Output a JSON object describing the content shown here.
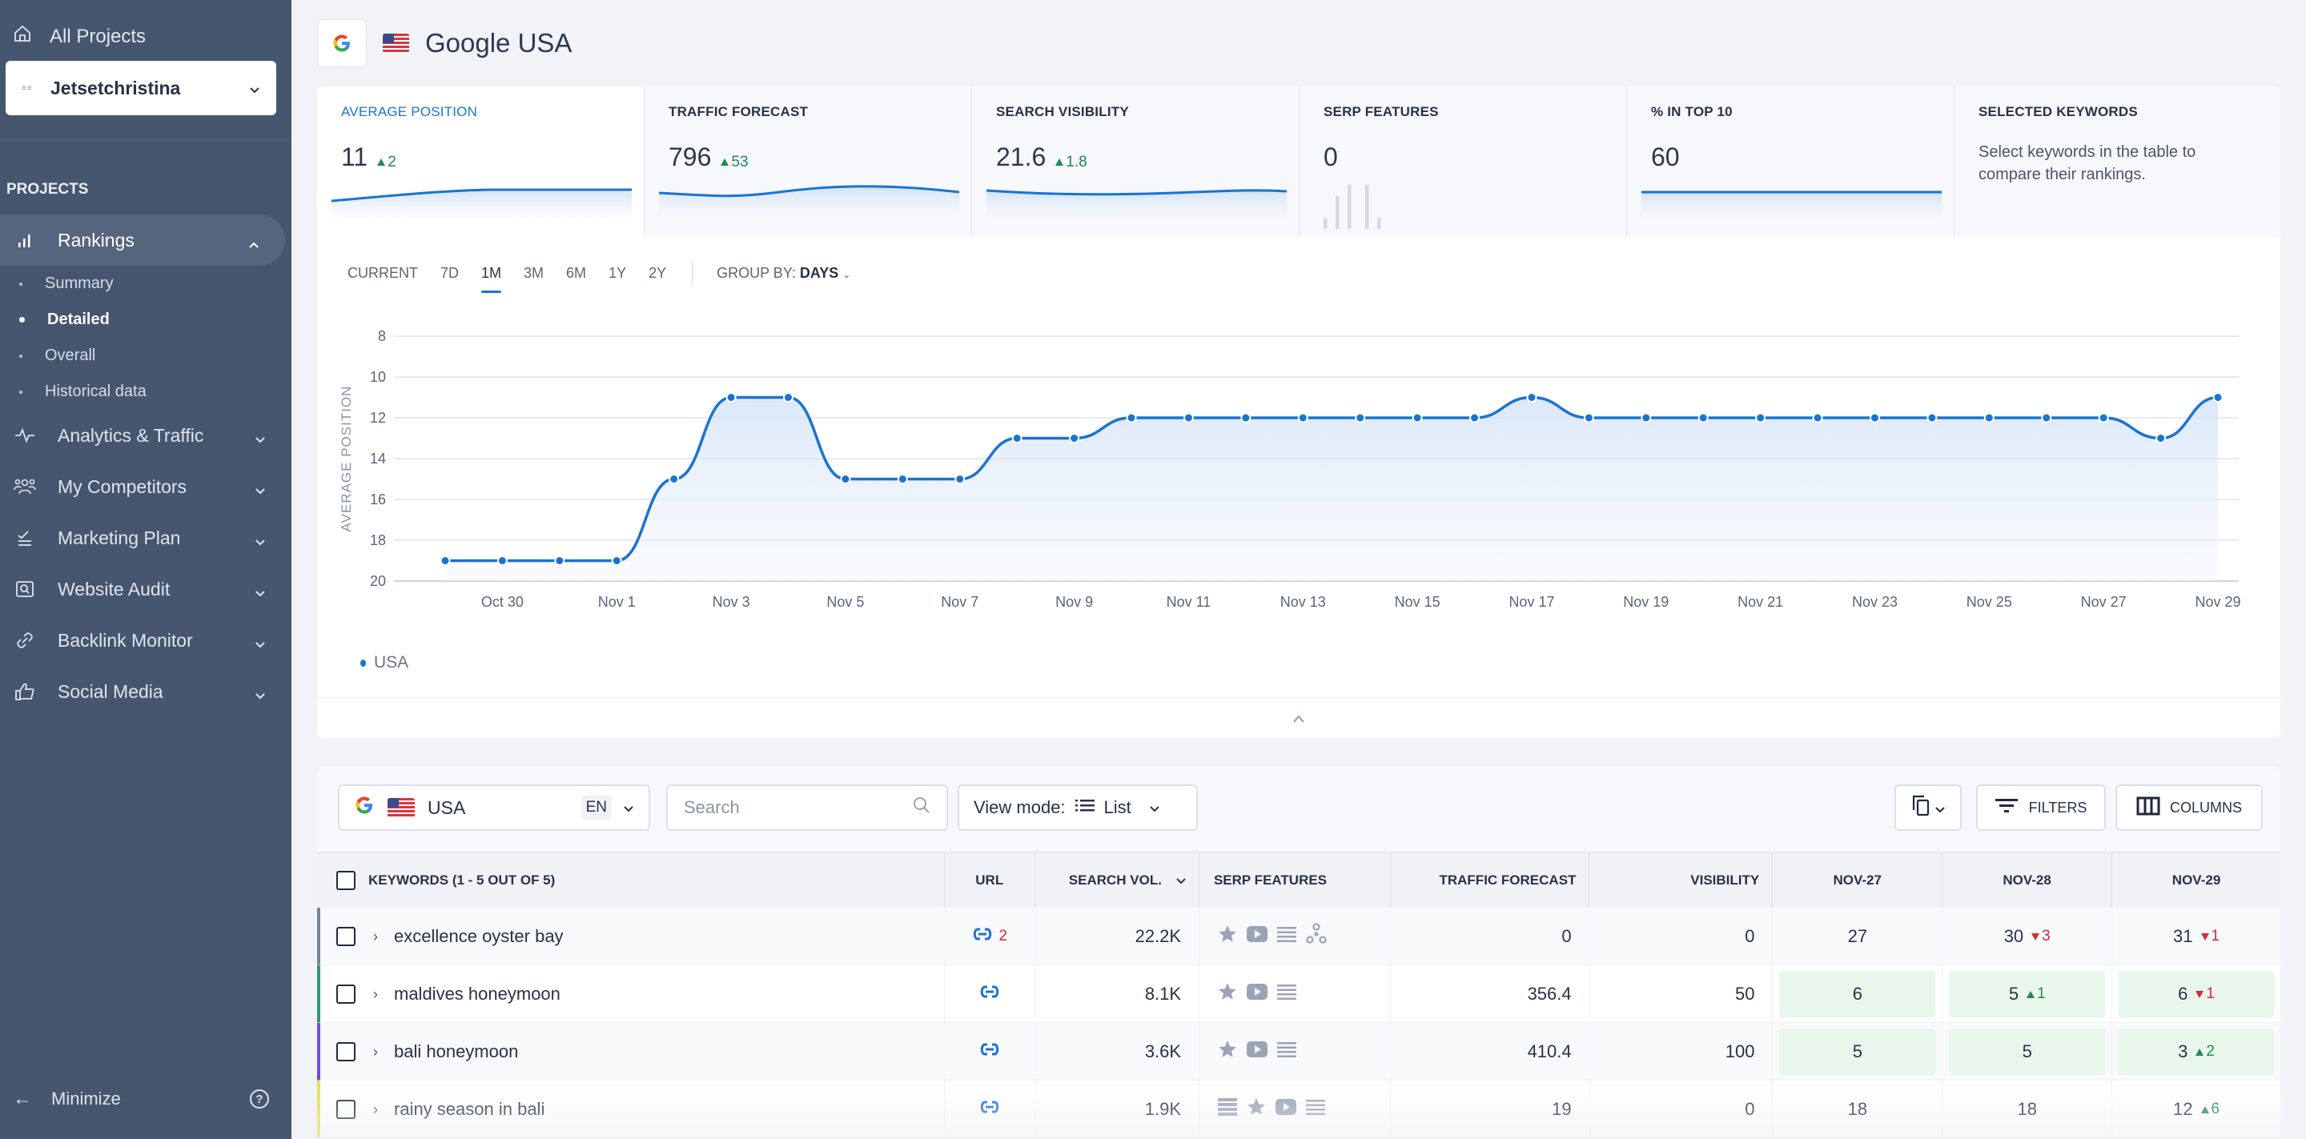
{
  "sidebar": {
    "all_projects": "All Projects",
    "project_name": "Jetsetchristina",
    "project_logo": "JET SET",
    "section_heading": "PROJECTS",
    "nav": [
      {
        "label": "Rankings",
        "icon": "bar-chart-icon",
        "expanded": true
      },
      {
        "label": "Analytics & Traffic",
        "icon": "pulse-icon"
      },
      {
        "label": "My Competitors",
        "icon": "users-icon"
      },
      {
        "label": "Marketing Plan",
        "icon": "checklist-icon"
      },
      {
        "label": "Website Audit",
        "icon": "audit-search-icon"
      },
      {
        "label": "Backlink Monitor",
        "icon": "link-icon"
      },
      {
        "label": "Social Media",
        "icon": "thumbs-up-icon"
      }
    ],
    "rankings_sub": [
      {
        "label": "Summary",
        "active": false
      },
      {
        "label": "Detailed",
        "active": true
      },
      {
        "label": "Overall",
        "active": false
      },
      {
        "label": "Historical data",
        "active": false
      }
    ],
    "minimize": "Minimize"
  },
  "header": {
    "title": "Google USA"
  },
  "metrics": [
    {
      "label": "AVERAGE POSITION",
      "value": "11",
      "delta": "2",
      "delta_dir": "up",
      "active": true
    },
    {
      "label": "TRAFFIC FORECAST",
      "value": "796",
      "delta": "53",
      "delta_dir": "up"
    },
    {
      "label": "SEARCH VISIBILITY",
      "value": "21.6",
      "delta": "1.8",
      "delta_dir": "up"
    },
    {
      "label": "SERP FEATURES",
      "value": "0"
    },
    {
      "label": "% IN TOP 10",
      "value": "60"
    },
    {
      "label": "SELECTED KEYWORDS",
      "description": "Select keywords in the table to compare their rankings."
    }
  ],
  "serp_feature_bars": [
    1,
    3,
    4,
    4,
    1
  ],
  "chart_controls": {
    "ranges": [
      "CURRENT",
      "7D",
      "1M",
      "3M",
      "6M",
      "1Y",
      "2Y"
    ],
    "active_range": "1M",
    "group_by_label": "GROUP BY:",
    "group_by_value": "DAYS"
  },
  "chart_data": {
    "type": "area",
    "title": "",
    "ylabel": "AVERAGE POSITION",
    "xlabel": "",
    "y_inverted": true,
    "ylim": [
      8,
      20
    ],
    "y_ticks": [
      8,
      10,
      12,
      14,
      16,
      18,
      20
    ],
    "x": [
      "Oct 29",
      "Oct 30",
      "Oct 31",
      "Nov 1",
      "Nov 2",
      "Nov 3",
      "Nov 4",
      "Nov 5",
      "Nov 6",
      "Nov 7",
      "Nov 8",
      "Nov 9",
      "Nov 10",
      "Nov 11",
      "Nov 12",
      "Nov 13",
      "Nov 14",
      "Nov 15",
      "Nov 16",
      "Nov 17",
      "Nov 18",
      "Nov 19",
      "Nov 20",
      "Nov 21",
      "Nov 22",
      "Nov 23",
      "Nov 24",
      "Nov 25",
      "Nov 26",
      "Nov 27",
      "Nov 28",
      "Nov 29"
    ],
    "x_tick_labels": [
      "Oct 30",
      "Nov 1",
      "Nov 3",
      "Nov 5",
      "Nov 7",
      "Nov 9",
      "Nov 11",
      "Nov 13",
      "Nov 15",
      "Nov 17",
      "Nov 19",
      "Nov 21",
      "Nov 23",
      "Nov 25",
      "Nov 27",
      "Nov 29"
    ],
    "series": [
      {
        "name": "USA",
        "color": "#1a73d2",
        "values": [
          19,
          19,
          19,
          19,
          15,
          11,
          11,
          15,
          15,
          15,
          13,
          13,
          12,
          12,
          12,
          12,
          12,
          12,
          12,
          11,
          12,
          12,
          12,
          12,
          12,
          12,
          12,
          12,
          12,
          12,
          13,
          11
        ]
      }
    ],
    "grid": true,
    "legend": "bottom-left"
  },
  "toolbar": {
    "engine": "USA",
    "language": "EN",
    "search_placeholder": "Search",
    "view_mode_label": "View mode:",
    "view_mode_value": "List",
    "filters": "FILTERS",
    "columns": "COLUMNS"
  },
  "table": {
    "headers": {
      "keywords": "KEYWORDS (1 - 5 OUT OF 5)",
      "url": "URL",
      "search_vol": "SEARCH VOL.",
      "serp": "SERP FEATURES",
      "traffic": "TRAFFIC FORECAST",
      "visibility": "VISIBILITY",
      "dates": [
        "NOV-27",
        "NOV-28",
        "NOV-29"
      ]
    },
    "rows": [
      {
        "keyword": "excellence oyster bay",
        "tag_color": "#7b8595",
        "url_count": "2",
        "search_vol": "22.2K",
        "serp": [
          "star",
          "video",
          "list",
          "knowledge"
        ],
        "traffic": "0",
        "visibility": "0",
        "positions": [
          {
            "value": "27",
            "delta": "",
            "dir": "",
            "top10": false
          },
          {
            "value": "30",
            "delta": "3",
            "dir": "down",
            "top10": false
          },
          {
            "value": "31",
            "delta": "1",
            "dir": "down",
            "top10": false
          }
        ]
      },
      {
        "keyword": "maldives honeymoon",
        "tag_color": "#2c9a7c",
        "url_count": "",
        "search_vol": "8.1K",
        "serp": [
          "star",
          "video",
          "list"
        ],
        "traffic": "356.4",
        "visibility": "50",
        "positions": [
          {
            "value": "6",
            "delta": "",
            "dir": "",
            "top10": true
          },
          {
            "value": "5",
            "delta": "1",
            "dir": "up",
            "top10": true
          },
          {
            "value": "6",
            "delta": "1",
            "dir": "down",
            "top10": true
          }
        ]
      },
      {
        "keyword": "bali honeymoon",
        "tag_color": "#6e4fd8",
        "url_count": "",
        "search_vol": "3.6K",
        "serp": [
          "star",
          "video",
          "list"
        ],
        "traffic": "410.4",
        "visibility": "100",
        "positions": [
          {
            "value": "5",
            "delta": "",
            "dir": "",
            "top10": true
          },
          {
            "value": "5",
            "delta": "",
            "dir": "",
            "top10": true
          },
          {
            "value": "3",
            "delta": "2",
            "dir": "up",
            "top10": true
          }
        ]
      },
      {
        "keyword": "rainy season in bali",
        "tag_color": "#e6e04a",
        "url_count": "",
        "search_vol": "1.9K",
        "serp": [
          "list-filled",
          "star",
          "video",
          "list"
        ],
        "traffic": "19",
        "visibility": "0",
        "positions": [
          {
            "value": "18",
            "delta": "",
            "dir": "",
            "top10": false
          },
          {
            "value": "18",
            "delta": "",
            "dir": "",
            "top10": false
          },
          {
            "value": "12",
            "delta": "6",
            "dir": "up",
            "top10": false
          }
        ]
      }
    ]
  }
}
